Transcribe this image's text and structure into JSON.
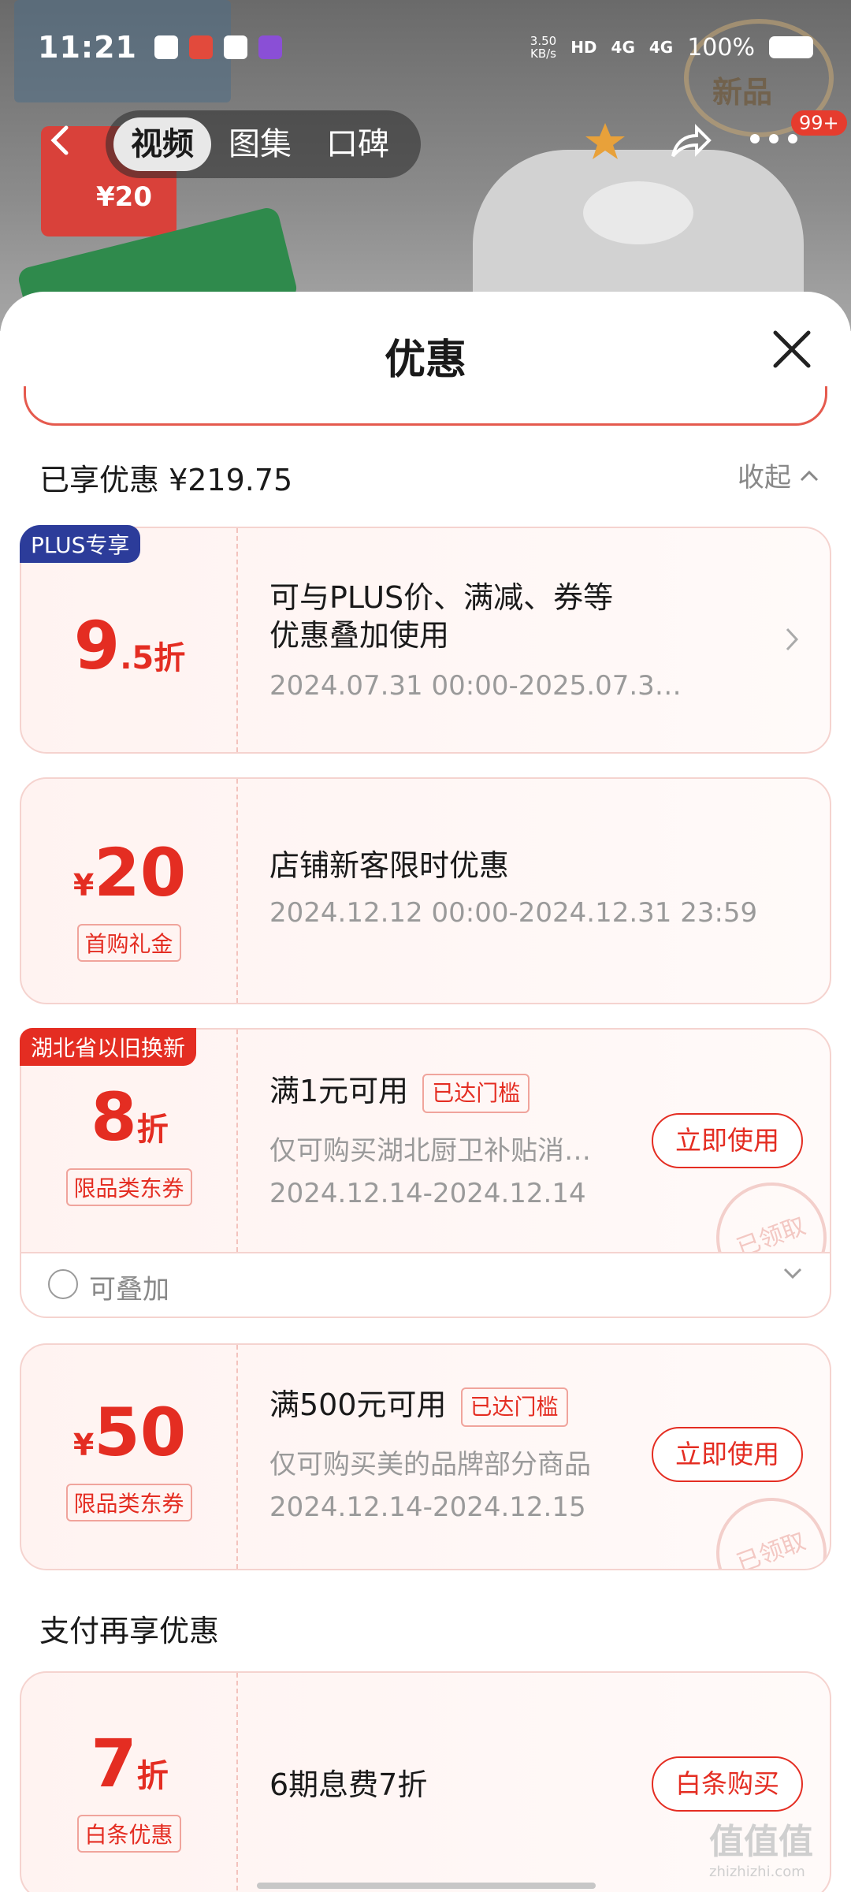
{
  "status_bar": {
    "time": "11:21",
    "net_speed": "3.50\nKB/s",
    "hd": "HD",
    "sim1": "4G",
    "sim2": "4G",
    "battery": "100%"
  },
  "background": {
    "seal_text": "新品",
    "card_text": "¥20"
  },
  "nav": {
    "tabs": [
      {
        "label": "视频",
        "active": true
      },
      {
        "label": "图集",
        "active": false
      },
      {
        "label": "口碑",
        "active": false
      }
    ],
    "msg_count": "99+"
  },
  "sheet": {
    "title": "优惠",
    "enjoyed_label": "已享优惠 ¥219.75",
    "collapse_label": "收起"
  },
  "coupons": [
    {
      "ribbon": "PLUS专享",
      "value_big": "9",
      "value_small": ".5折",
      "title_line1": "可与PLUS价、满减、券等",
      "title_line2": "优惠叠加使用",
      "date": "2024.07.31 00:00-2025.07.3…"
    },
    {
      "currency": "¥",
      "value_big": "20",
      "tag": "首购礼金",
      "title": "店铺新客限时优惠",
      "date": "2024.12.12 00:00-2024.12.31 23:59"
    },
    {
      "ribbon": "湖北省以旧换新",
      "value_big": "8",
      "value_small": "折",
      "tag": "限品类东券",
      "title": "满1元可用",
      "reached": "已达门槛",
      "desc": "仅可购买湖北厨卫补贴消…",
      "date": "2024.12.14-2024.12.14",
      "action": "立即使用",
      "stamp": "已领取",
      "stack_label": "可叠加"
    },
    {
      "currency": "¥",
      "value_big": "50",
      "tag": "限品类东券",
      "title": "满500元可用",
      "reached": "已达门槛",
      "desc": "仅可购买美的品牌部分商品",
      "date": "2024.12.14-2024.12.15",
      "action": "立即使用",
      "stamp": "已领取"
    }
  ],
  "payment": {
    "section_label": "支付再享优惠",
    "value_big": "7",
    "value_small": "折",
    "tag": "白条优惠",
    "title": "6期息费7折",
    "action": "白条购买"
  },
  "watermark": {
    "text": "值值值",
    "domain": "zhizhizhi.com"
  }
}
